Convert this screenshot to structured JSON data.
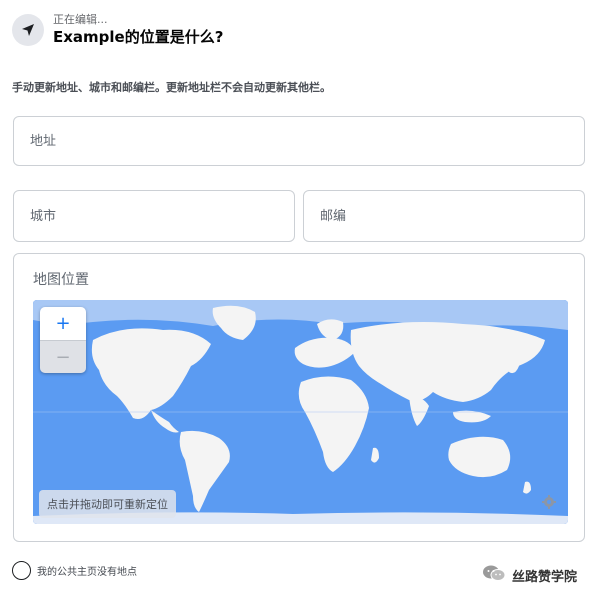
{
  "header": {
    "editing_label": "正在编辑...",
    "title": "Example的位置是什么?"
  },
  "description": "手动更新地址、城市和邮编栏。更新地址栏不会自动更新其他栏。",
  "fields": {
    "address_placeholder": "地址",
    "city_placeholder": "城市",
    "zip_placeholder": "邮编"
  },
  "map": {
    "label": "地图位置",
    "zoom_in": "+",
    "zoom_out": "−",
    "hint": "点击并拖动即可重新定位"
  },
  "no_location": {
    "label": "我的公共主页没有地点"
  },
  "watermark": {
    "text": "丝路赞学院"
  },
  "colors": {
    "ocean": "#5b9bf2",
    "land": "#f4f4f4",
    "accent": "#1877f2"
  }
}
